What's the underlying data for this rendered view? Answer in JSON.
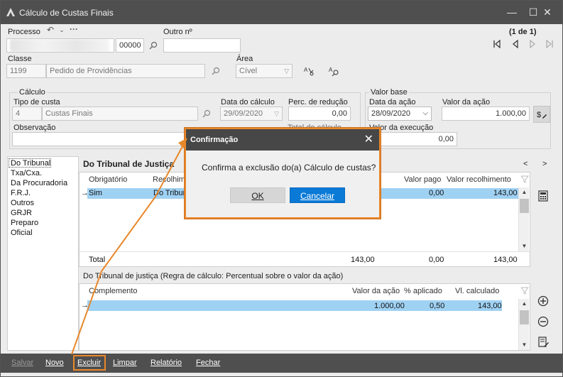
{
  "window": {
    "title": "Cálculo de Custas Finais",
    "minimize": "—",
    "maximize": "☐",
    "close": "✕"
  },
  "processo": {
    "label": "Processo",
    "number_suffix": "00000",
    "outro_label": "Outro nº",
    "outro_value": "",
    "pagination": "(1 de 1)"
  },
  "classe": {
    "label": "Classe",
    "code": "1199",
    "name": "Pedido de Providências",
    "area_label": "Área",
    "area_value": "Cível"
  },
  "calculo": {
    "group_label": "Cálculo",
    "tipo_label": "Tipo de custa",
    "tipo_code": "4",
    "tipo_name": "Custas Finais",
    "data_label": "Data do cálculo",
    "data_value": "29/09/2020",
    "perc_label": "Perc. de redução",
    "perc_value": "0,00",
    "obs_label": "Observação",
    "obs_value": "",
    "hidden_label": "Total do cálculo"
  },
  "valor_base": {
    "group_label": "Valor base",
    "data_acao_label": "Data da ação",
    "data_acao_value": "28/09/2020",
    "valor_acao_label": "Valor da ação",
    "valor_acao_value": "1.000,00",
    "valor_exec_label": "Valor da execução",
    "valor_exec_value": "0,00"
  },
  "sidebar": {
    "items": [
      {
        "label": "Do Tribunal"
      },
      {
        "label": "Txa/Cxa."
      },
      {
        "label": "Da Procuradoria"
      },
      {
        "label": "F.R.J."
      },
      {
        "label": "Outros"
      },
      {
        "label": "GRJR"
      },
      {
        "label": "Preparo"
      },
      {
        "label": "Oficial"
      }
    ]
  },
  "section1": {
    "title": "Do Tribunal de Justiça",
    "nav_prev": "<",
    "nav_next": ">",
    "headers": {
      "obrigatorio": "Obrigatório",
      "recolhimento": "Recolhim",
      "valor_pago": "Valor pago",
      "valor_recolhimento": "Valor recolhimento"
    },
    "row": {
      "marker": "→",
      "obrigatorio": "Sim",
      "recolhimento": "Do Tribun",
      "valor_pago": "0,00",
      "valor_recolhimento": "143,00"
    },
    "total": {
      "label": "Total",
      "v1": "143,00",
      "v2": "0,00",
      "v3": "143,00"
    }
  },
  "section2": {
    "title": "Do Tribunal de justiça (Regra de cálculo: Percentual sobre o valor da ação)",
    "headers": {
      "complemento": "Complemento",
      "valor_acao": "Valor da ação",
      "aplicado": "% aplicado",
      "calculado": "Vl. calculado"
    },
    "row": {
      "marker": "→",
      "valor_acao": "1.000,00",
      "aplicado": "0,50",
      "calculado": "143,00"
    }
  },
  "bottombar": {
    "salvar": "Salvar",
    "novo": "Novo",
    "excluir": "Excluir",
    "limpar": "Limpar",
    "relatorio": "Relatório",
    "fechar": "Fechar"
  },
  "dialog": {
    "title": "Confirmação",
    "message": "Confirma a exclusão do(a) Cálculo de custas?",
    "ok": "OK",
    "cancel": "Cancelar",
    "close": "✕"
  },
  "colors": {
    "highlight": "#e8872a",
    "selected_row": "#9fd1f3",
    "primary_button": "#0a7ad6",
    "titlebar": "#4f4f4f"
  }
}
